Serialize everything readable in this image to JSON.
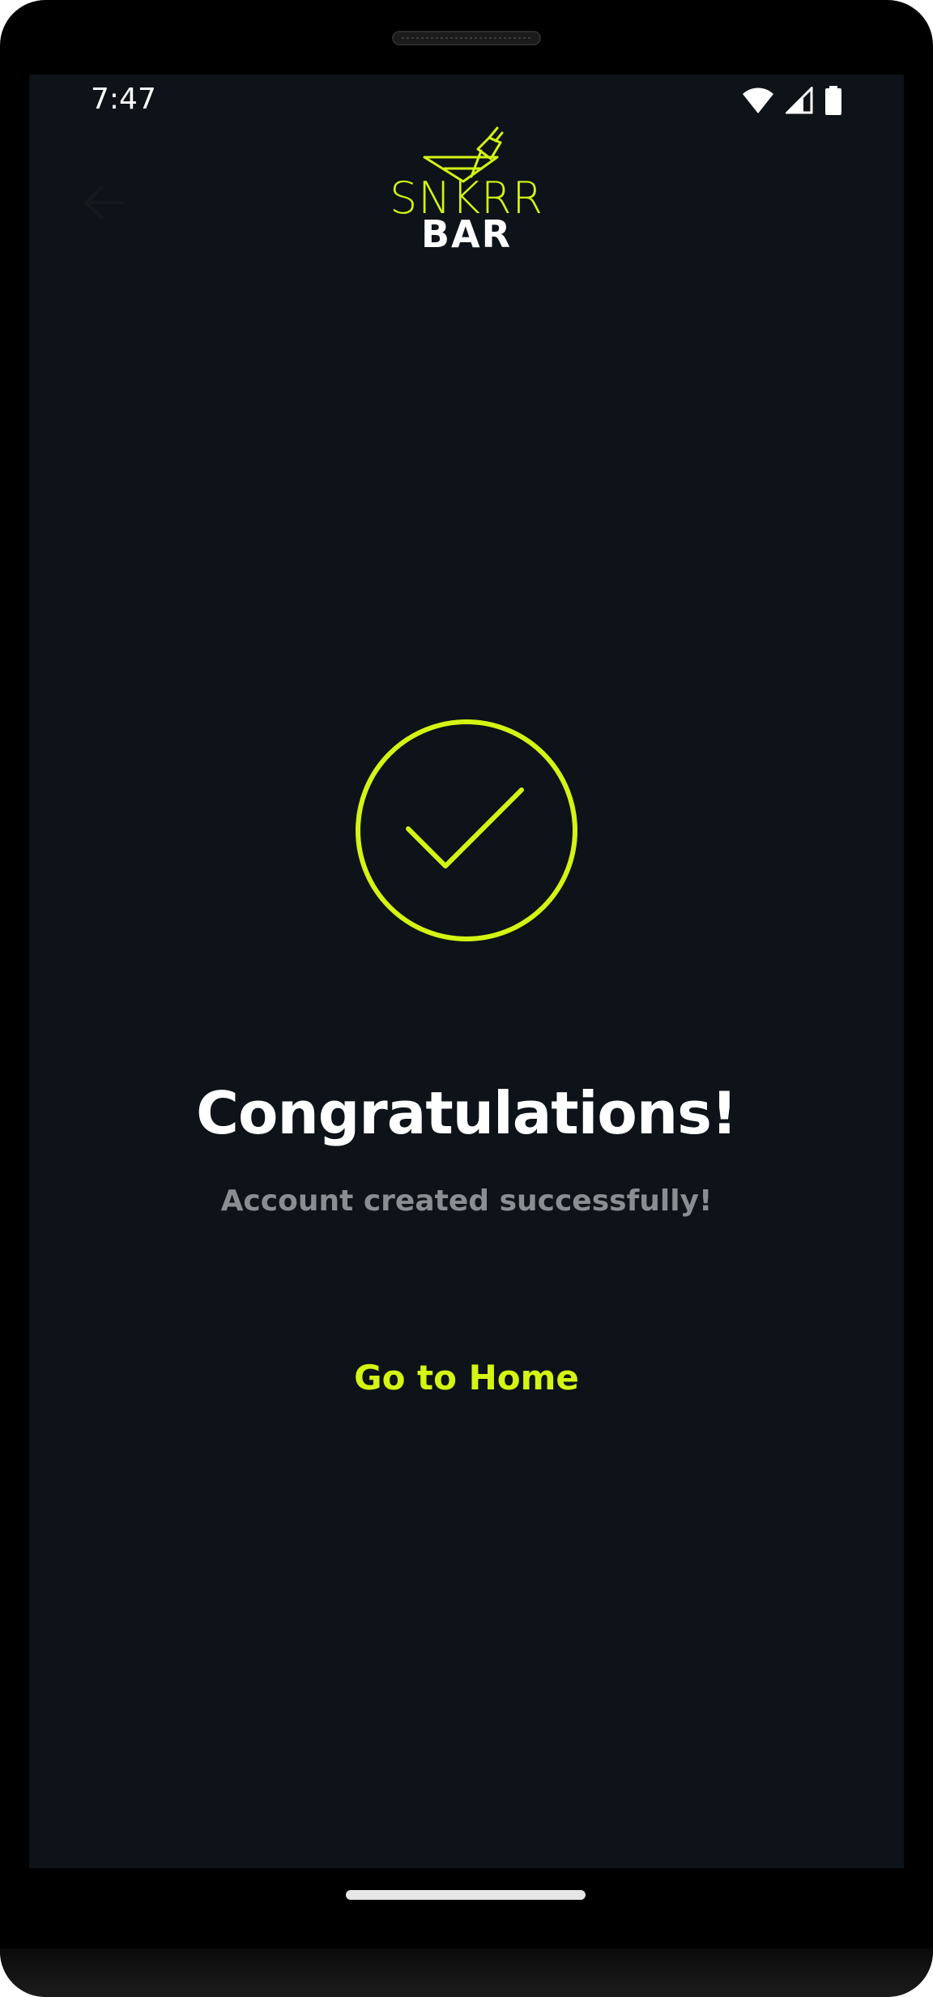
{
  "status_bar": {
    "time": "7:47",
    "icons": [
      "wifi-icon",
      "cellular-signal-icon",
      "battery-icon"
    ]
  },
  "header": {
    "back_icon": "arrow-left-icon",
    "logo": {
      "line1": "SNKRR",
      "line2": "BAR"
    }
  },
  "main": {
    "status_icon": "check-circle-icon",
    "title": "Congratulations!",
    "subtitle": "Account created successfully!",
    "cta_label": "Go to Home"
  },
  "colors": {
    "background": "#0d1318",
    "accent": "#d4f413",
    "title": "#ffffff",
    "subtitle": "#8a8e93"
  }
}
